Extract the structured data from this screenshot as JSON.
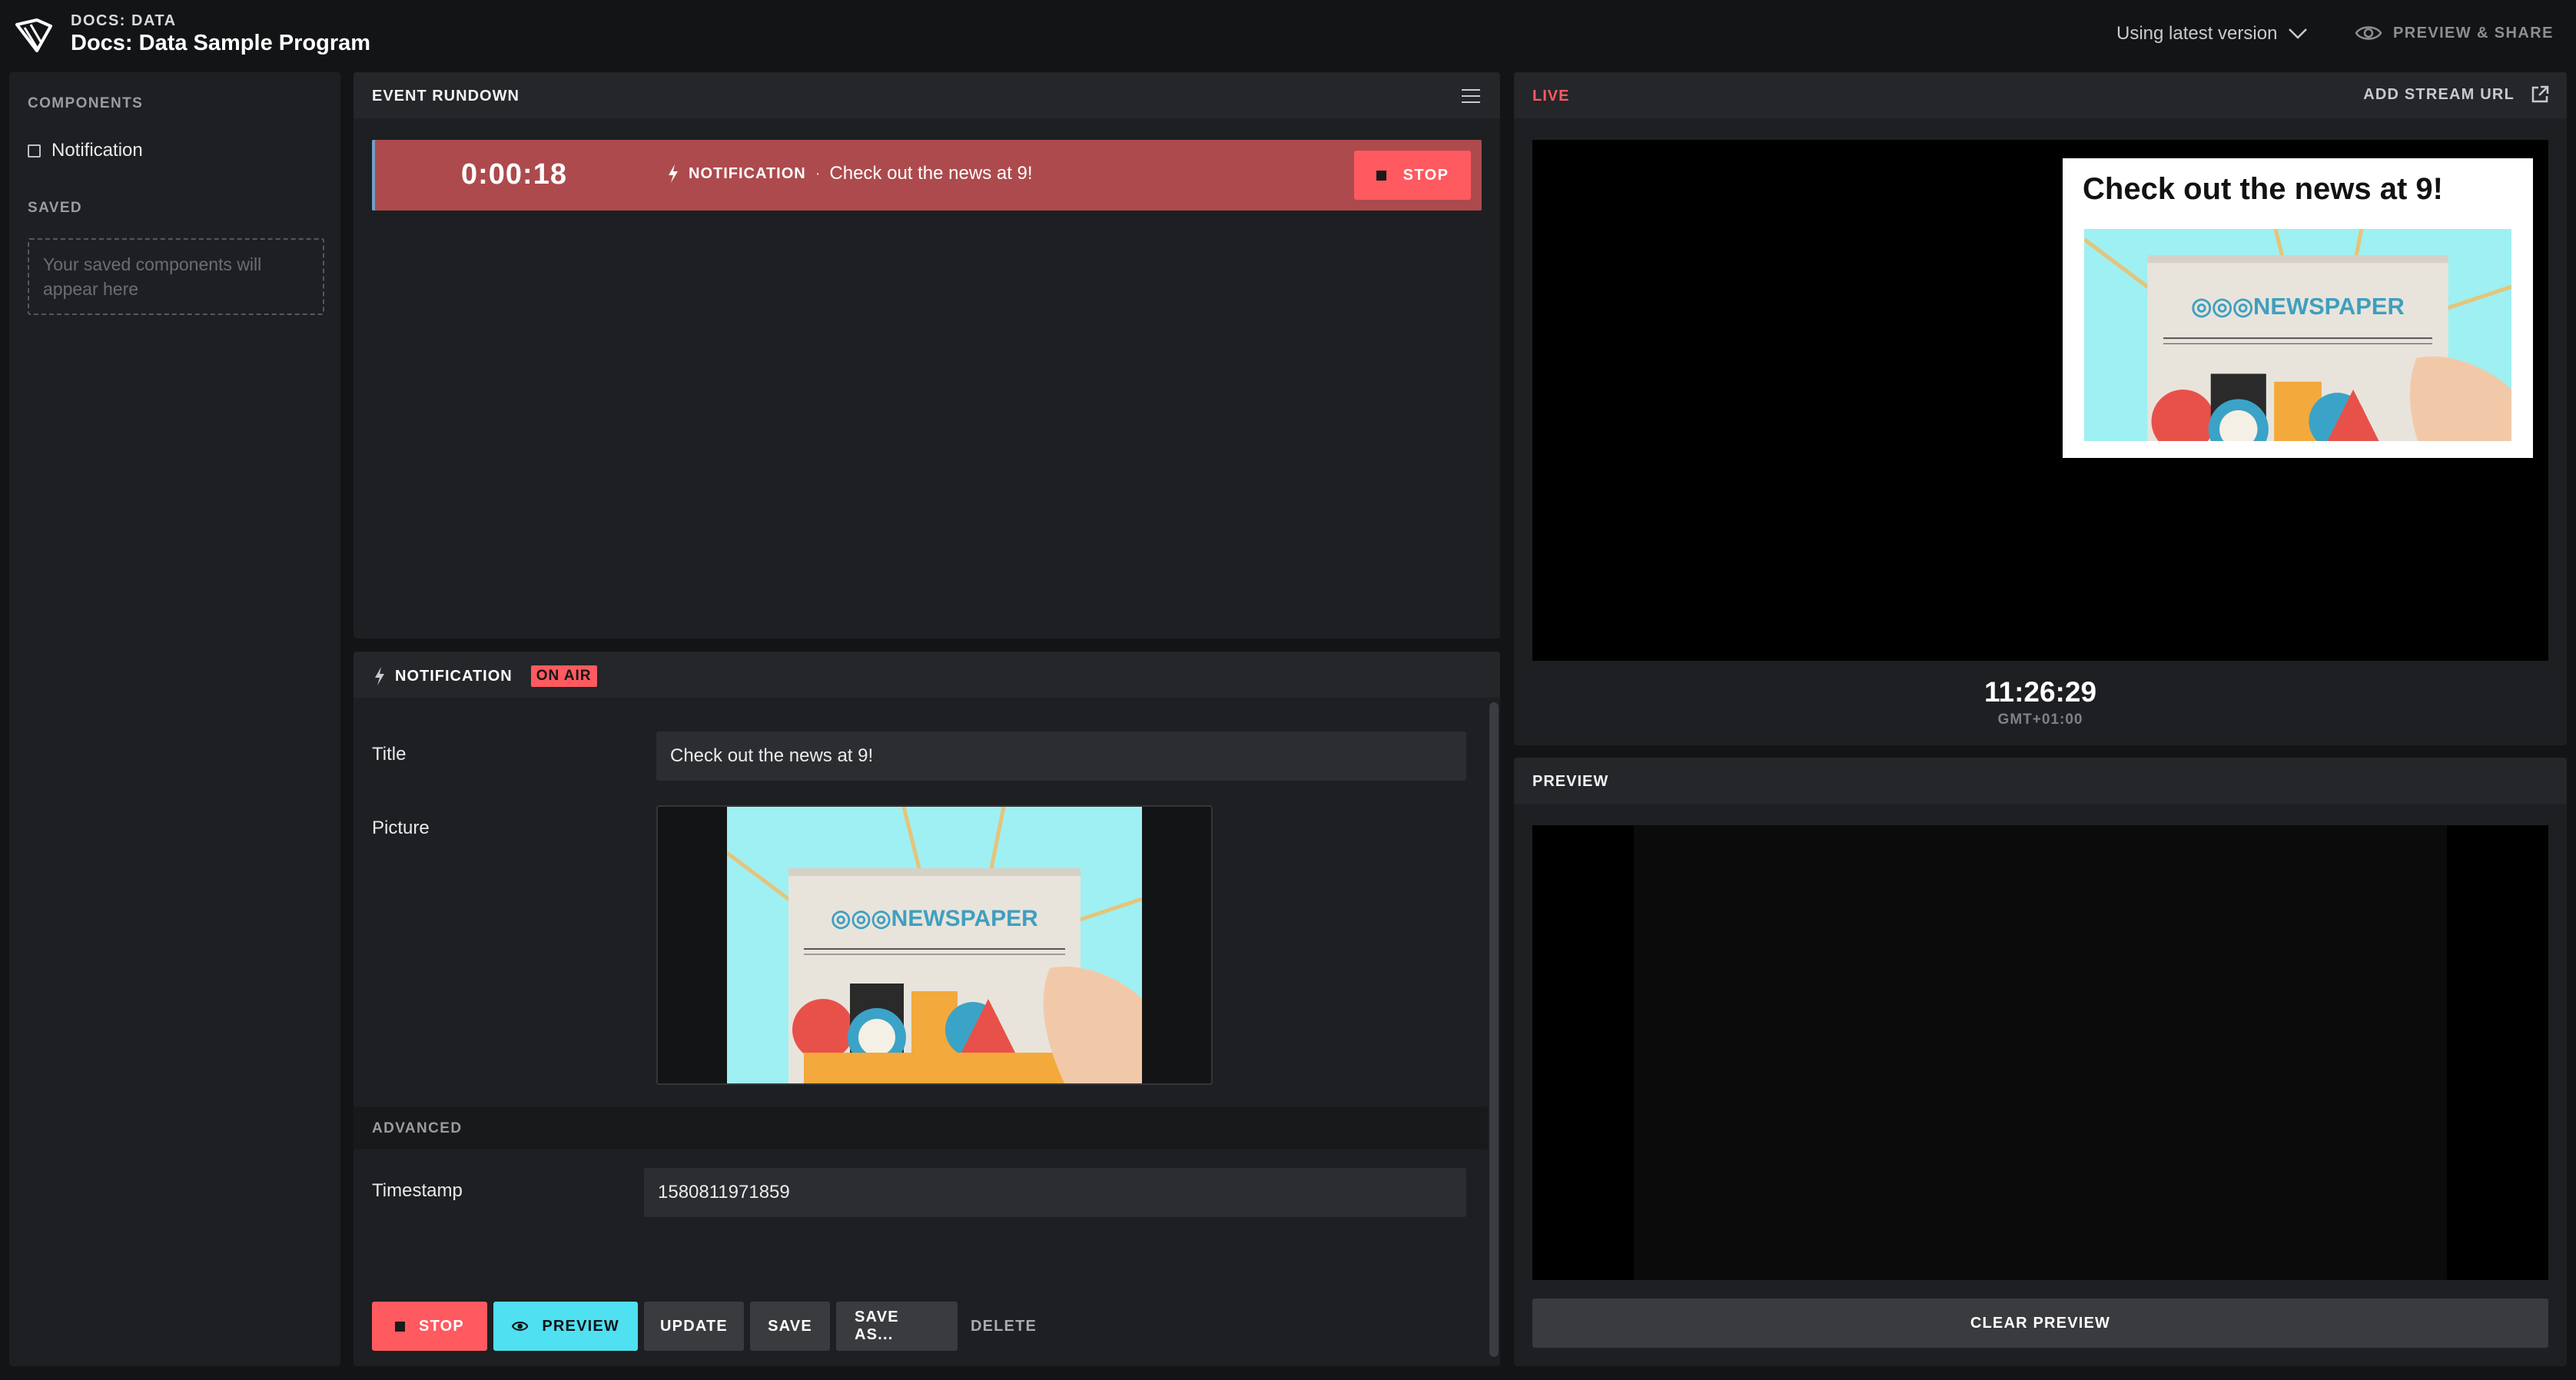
{
  "app": {
    "subtitle": "DOCS: DATA",
    "title": "Docs: Data Sample Program",
    "version_label": "Using latest version",
    "preview_share_label": "PREVIEW & SHARE"
  },
  "sidebar": {
    "components_heading": "COMPONENTS",
    "components": [
      {
        "label": "Notification",
        "icon": "checkbox-icon"
      }
    ],
    "saved_heading": "SAVED",
    "saved_placeholder": "Your saved components will appear here"
  },
  "rundown": {
    "title": "EVENT RUNDOWN",
    "menu_icon": "hamburger-icon",
    "items": [
      {
        "elapsed": "0:00:18",
        "kind": "NOTIFICATION",
        "separator": "·",
        "text": "Check out the news at 9!",
        "stop_label": "STOP",
        "icon": "bolt-icon"
      }
    ]
  },
  "editor": {
    "component_name": "NOTIFICATION",
    "status_badge": "ON AIR",
    "fields": {
      "title_label": "Title",
      "title_value": "Check out the news at 9!",
      "picture_label": "Picture",
      "advanced_heading": "ADVANCED",
      "timestamp_label": "Timestamp",
      "timestamp_value": "1580811971859"
    },
    "buttons": {
      "stop": "STOP",
      "preview": "PREVIEW",
      "update": "UPDATE",
      "save": "SAVE",
      "save_as": "SAVE AS...",
      "delete": "DELETE"
    }
  },
  "live": {
    "label": "LIVE",
    "add_stream_label": "ADD STREAM URL",
    "overlay_title": "Check out the news at 9!",
    "clock_time": "11:26:29",
    "clock_timezone": "GMT+01:00"
  },
  "preview": {
    "title": "PREVIEW",
    "clear_label": "CLEAR PREVIEW"
  },
  "colors": {
    "background": "#131416",
    "panel": "#1e1f22",
    "accent_red": "#ff5a5f",
    "accent_cyan": "#4fe0f2",
    "rundown_item": "#ad4a4d"
  }
}
